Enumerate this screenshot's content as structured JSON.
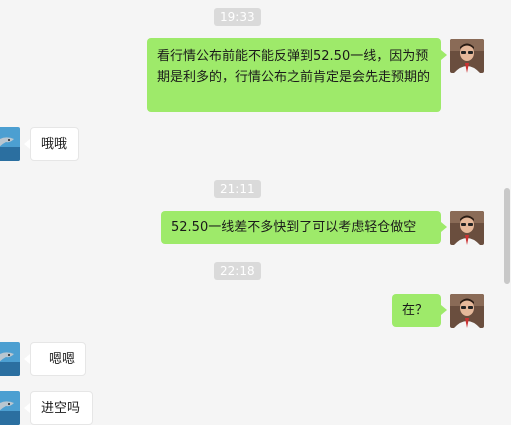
{
  "chat": {
    "timestamps": [
      "19:33",
      "21:11",
      "22:18"
    ],
    "messages": [
      {
        "text": "看行情公布前能不能反弹到52.50一线，因为预期是利多的，行情公布之前肯定是会先走预期的"
      },
      {
        "text": "哦哦"
      },
      {
        "text": "52.50一线差不多快到了可以考虑轻仓做空"
      },
      {
        "text": "在？"
      },
      {
        "text": "嗯嗯"
      },
      {
        "text": "进空吗"
      }
    ]
  },
  "colors": {
    "outgoing_bubble": "#9eea6a",
    "incoming_bubble": "#ffffff",
    "background": "#f5f5f5",
    "timestamp_bg": "#dadada"
  },
  "icons": {
    "self_avatar": "man-portrait-avatar",
    "contact_avatar": "dolphin-avatar"
  }
}
